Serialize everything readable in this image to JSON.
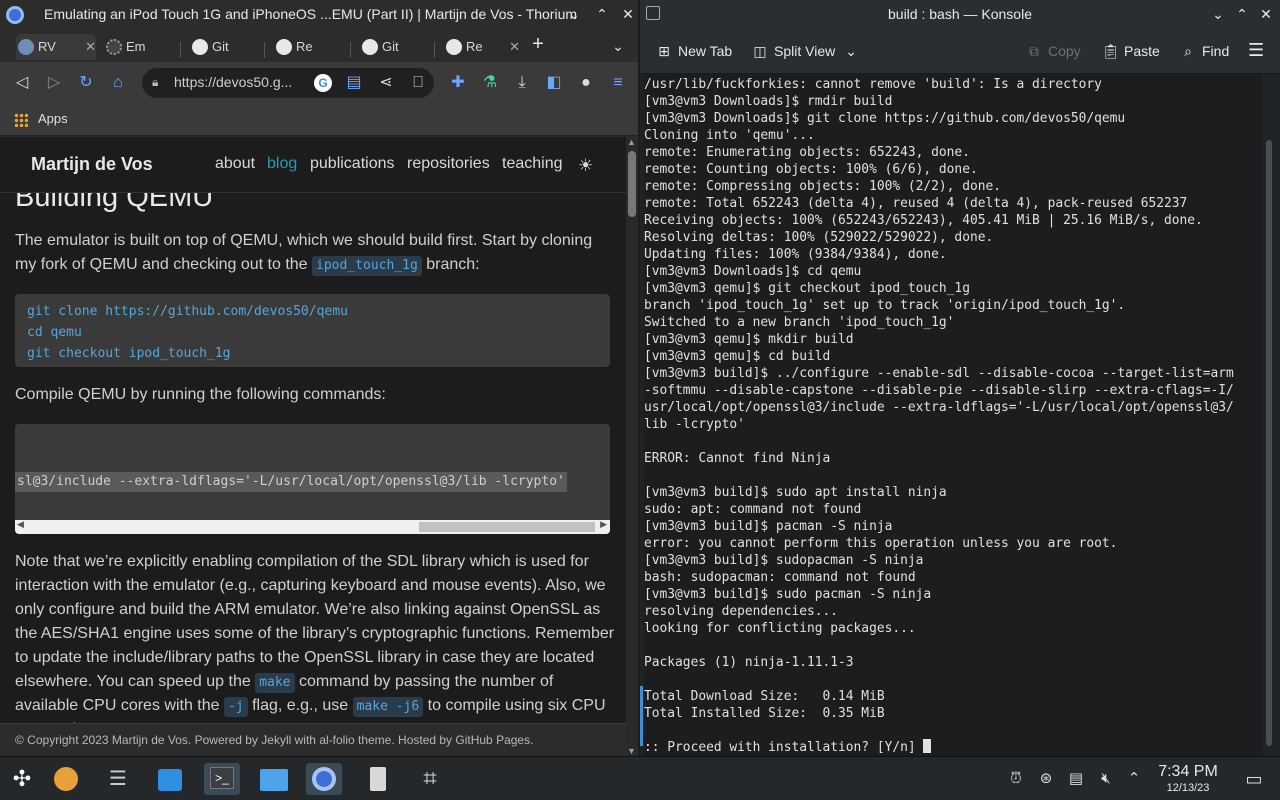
{
  "browser": {
    "title": "Emulating an iPod Touch 1G and iPhoneOS ...EMU (Part II) | Martijn de Vos - Thorium",
    "tabs": [
      {
        "label": "RV"
      },
      {
        "label": "Em"
      },
      {
        "label": "Git"
      },
      {
        "label": "Re"
      },
      {
        "label": "Git"
      },
      {
        "label": "Re"
      }
    ],
    "url": "https://devos50.g...",
    "bookmarks_apps": "Apps"
  },
  "site": {
    "brand": "Martijn de Vos",
    "nav": [
      "about",
      "blog",
      "publications",
      "repositories",
      "teaching"
    ],
    "heading": "Building QEMU",
    "para1_a": "The emulator is built on top of QEMU, which we should build first. Start by cloning my fork of QEMU and checking out to the ",
    "para1_code": "ipod_touch_1g",
    "para1_b": " branch:",
    "code1": [
      "git clone https://github.com/devos50/qemu",
      "cd qemu",
      "git checkout ipod_touch_1g"
    ],
    "para2": "Compile QEMU by running the following commands:",
    "code2": "sl@3/include --extra-ldflags='-L/usr/local/opt/openssl@3/lib -lcrypto'",
    "para3_a": "Note that we’re explicitly enabling compilation of the SDL library which is used for interaction with the emulator (e.g., capturing keyboard and mouse events). Also, we only configure and build the ARM emulator. We’re also linking against OpenSSL as the AES/SHA1 engine uses some of the library’s cryptographic functions. Remember to update the include/library paths to the OpenSSL library in case they are located elsewhere. You can speed up the ",
    "para3_code1": "make",
    "para3_b": " command by passing the number of available CPU cores with the ",
    "para3_code2": "-j",
    "para3_c": " flag, e.g., use ",
    "para3_code3": "make -j6",
    "para3_d": " to compile using six CPU cores. The",
    "footer": "© Copyright 2023 Martijn de Vos. Powered by Jekyll with al-folio theme. Hosted by GitHub Pages."
  },
  "konsole": {
    "title": "build : bash — Konsole",
    "new_tab": "New Tab",
    "split_view": "Split View",
    "copy": "Copy",
    "paste": "Paste",
    "find": "Find",
    "lines": [
      "/usr/lib/fuckforkies: cannot remove 'build': Is a directory",
      "[vm3@vm3 Downloads]$ rmdir build",
      "[vm3@vm3 Downloads]$ git clone https://github.com/devos50/qemu",
      "Cloning into 'qemu'...",
      "remote: Enumerating objects: 652243, done.",
      "remote: Counting objects: 100% (6/6), done.",
      "remote: Compressing objects: 100% (2/2), done.",
      "remote: Total 652243 (delta 4), reused 4 (delta 4), pack-reused 652237",
      "Receiving objects: 100% (652243/652243), 405.41 MiB | 25.16 MiB/s, done.",
      "Resolving deltas: 100% (529022/529022), done.",
      "Updating files: 100% (9384/9384), done.",
      "[vm3@vm3 Downloads]$ cd qemu",
      "[vm3@vm3 qemu]$ git checkout ipod_touch_1g",
      "branch 'ipod_touch_1g' set up to track 'origin/ipod_touch_1g'.",
      "Switched to a new branch 'ipod_touch_1g'",
      "[vm3@vm3 qemu]$ mkdir build",
      "[vm3@vm3 qemu]$ cd build",
      "[vm3@vm3 build]$ ../configure --enable-sdl --disable-cocoa --target-list=arm",
      "-softmmu --disable-capstone --disable-pie --disable-slirp --extra-cflags=-I/",
      "usr/local/opt/openssl@3/include --extra-ldflags='-L/usr/local/opt/openssl@3/",
      "lib -lcrypto'",
      "",
      "ERROR: Cannot find Ninja",
      "",
      "[vm3@vm3 build]$ sudo apt install ninja",
      "sudo: apt: command not found",
      "[vm3@vm3 build]$ pacman -S ninja",
      "error: you cannot perform this operation unless you are root.",
      "[vm3@vm3 build]$ sudopacman -S ninja",
      "bash: sudopacman: command not found",
      "[vm3@vm3 build]$ sudo pacman -S ninja",
      "resolving dependencies...",
      "looking for conflicting packages...",
      "",
      "Packages (1) ninja-1.11.1-3",
      "",
      "Total Download Size:   0.14 MiB",
      "Total Installed Size:  0.35 MiB",
      "",
      ":: Proceed with installation? [Y/n] "
    ]
  },
  "taskbar": {
    "time": "7:34 PM",
    "date": "12/13/23"
  }
}
